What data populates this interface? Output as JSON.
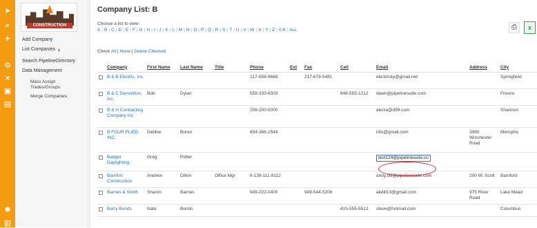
{
  "rail": {
    "icons": [
      "paper-plane-icon",
      "search-icon",
      "plus-icon",
      "sliders-icon",
      "tools-icon",
      "id-card-icon",
      "clipboard-icon",
      "gear-icon",
      "chart-icon"
    ]
  },
  "sidebar": {
    "logo_text": "CONSTRUCTION",
    "items": [
      {
        "label": "Add Company"
      },
      {
        "label": "List Companies"
      },
      {
        "label": "Search PipelineDirectory"
      },
      {
        "label": "Data Management"
      }
    ],
    "subitems": [
      {
        "label": "Mass Assign Trades/Groups"
      },
      {
        "label": "Merge Companies"
      }
    ]
  },
  "main": {
    "title": "Company List: B",
    "choose_label": "Choose a list to view:",
    "letters": [
      "A",
      "B",
      "C",
      "D",
      "E",
      "F",
      "G",
      "H",
      "I",
      "J",
      "K",
      "L",
      "M",
      "N",
      "O",
      "P",
      "Q",
      "R",
      "S",
      "T",
      "U",
      "V",
      "W",
      "X",
      "Y",
      "Z",
      "0-9",
      "ALL"
    ],
    "check_label": "Check",
    "check_all": "All",
    "check_none": "None",
    "delete_checked": "Delete Checked",
    "print_icon": "printer-icon",
    "excel_icon": "excel-export-icon"
  },
  "table": {
    "headers": [
      "Company",
      "First Name",
      "Last Name",
      "Title",
      "Phone",
      "Ext",
      "Fax",
      "Cell",
      "Email",
      "Address",
      "City"
    ],
    "rows": [
      {
        "company": "B & B Electric, Inc.",
        "first": "",
        "last": "",
        "title": "",
        "phone": "217-658-9666",
        "ext": "",
        "fax": "217-678-5481",
        "cell": "",
        "email": "electricity@gmail.net",
        "address": "",
        "city": "Springfield"
      },
      {
        "company": "B & C Demolition, Inc.",
        "first": "Bob",
        "last": "Dylan",
        "title": "",
        "phone": "559-333-8303",
        "ext": "",
        "fax": "",
        "cell": "848-555-1212",
        "email": "dawn@pipelinesuite.com",
        "address": "",
        "city": "Fresno"
      },
      {
        "company": "B & H Contracting Company Inc",
        "first": "",
        "last": "",
        "title": "",
        "phone": "256-200-5000",
        "ext": "",
        "fax": "",
        "cell": "",
        "email": "alecia@d99.com",
        "address": "",
        "city": "Shannon"
      },
      {
        "company": "B FOUR PLIED, INC.",
        "first": "Debbie",
        "last": "Boren",
        "title": "",
        "phone": "654-366-1544",
        "ext": "",
        "fax": "",
        "cell": "",
        "email": "info@gmail.com",
        "address": "3980 Winchester Road",
        "city": "Memphis"
      },
      {
        "company": "Badger Daylighting",
        "first": "Greg",
        "last": "Potter",
        "title": "",
        "phone": "",
        "ext": "",
        "fax": "",
        "cell": "",
        "email": "test124@pipelinesuite.co",
        "address": "",
        "city": ""
      },
      {
        "company": "Bamfort Construction",
        "first": "Andrew",
        "last": "Dillon",
        "title": "Office Mgr",
        "phone": "6-138-111-8112",
        "ext": "",
        "fax": "",
        "cell": "",
        "email": "andy.dill@pipelinesuite.com",
        "address": "200 W. Scott",
        "city": "Bamford"
      },
      {
        "company": "Barnes & Smith",
        "first": "Sharon",
        "last": "Barnes",
        "title": "",
        "phone": "949-222-0400",
        "ext": "",
        "fax": "949-544-5206",
        "cell": "",
        "email": "akdill13@gmail.com",
        "address": "975 River Road",
        "city": "Lake Mead"
      },
      {
        "company": "Barry Bonds",
        "first": "Nate",
        "last": "Bonds",
        "title": "",
        "phone": "",
        "ext": "",
        "fax": "",
        "cell": "415-555-5512",
        "email": "steve@hotmail.com",
        "address": "",
        "city": "Columbus"
      }
    ]
  }
}
